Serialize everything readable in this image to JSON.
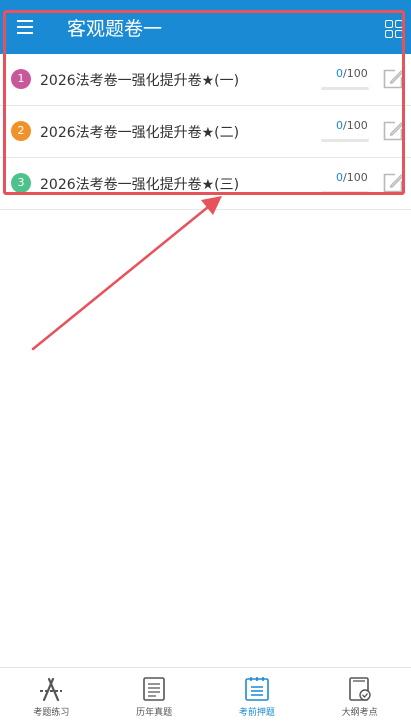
{
  "header": {
    "title": "客观题卷一"
  },
  "exams": [
    {
      "num": "1",
      "title": "2026法考卷一强化提升卷★(一)",
      "done": "0",
      "total": "/100",
      "progress": 0,
      "badge_color": "#c9589a"
    },
    {
      "num": "2",
      "title": "2026法考卷一强化提升卷★(二)",
      "done": "0",
      "total": "/100",
      "progress": 0,
      "badge_color": "#f0922b"
    },
    {
      "num": "3",
      "title": "2026法考卷一强化提升卷★(三)",
      "done": "0",
      "total": "/100",
      "progress": 0,
      "badge_color": "#4ec28a"
    }
  ],
  "tabs": [
    {
      "label": "考题练习",
      "icon": "practice-icon",
      "active": false
    },
    {
      "label": "历年真题",
      "icon": "past-exams-icon",
      "active": false
    },
    {
      "label": "考前押题",
      "icon": "prediction-icon",
      "active": true
    },
    {
      "label": "大纲考点",
      "icon": "syllabus-icon",
      "active": false
    }
  ],
  "colors": {
    "header_bg": "#1a8ad4",
    "accent": "#1a8ad4",
    "annotation": "#e8525b"
  }
}
